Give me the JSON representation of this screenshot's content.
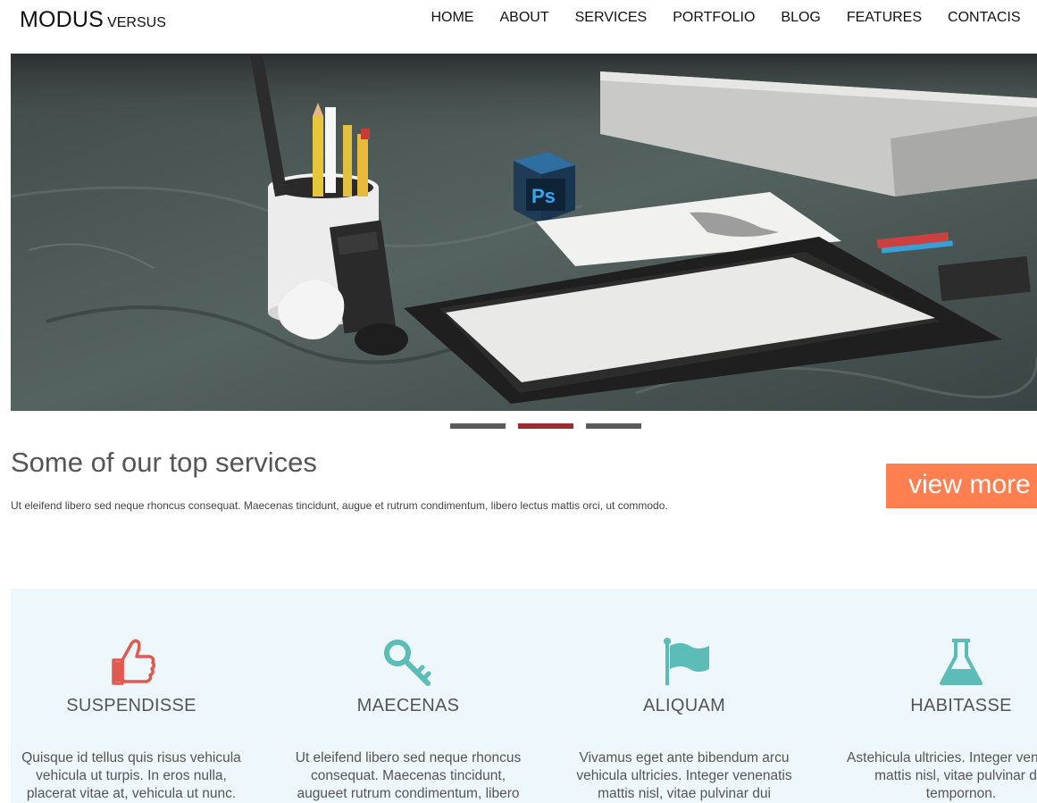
{
  "header": {
    "logo_main": "MODUS",
    "logo_sub": "VERSUS",
    "nav": [
      "HOME",
      "ABOUT",
      "SERVICES",
      "PORTFOLIO",
      "BLOG",
      "FEATURES",
      "CONTACIS"
    ]
  },
  "slider": {
    "slide_count": 3,
    "active_index": 1,
    "photoshop_label": "Ps"
  },
  "services": {
    "title": "Some of our top services",
    "text": "Ut eleifend libero sed neque rhoncus consequat. Maecenas tincidunt, augue et rutrum condimentum, libero lectus mattis orci, ut commodo.",
    "button_label": "view more"
  },
  "features": [
    {
      "icon": "thumbs-up-icon",
      "title": "SUSPENDISSE",
      "text": "Quisque id tellus quis risus vehicula vehicula ut turpis. In eros nulla, placerat vitae at, vehicula ut nunc."
    },
    {
      "icon": "key-icon",
      "title": "MAECENAS",
      "text": "Ut eleifend libero sed neque rhoncus consequat. Maecenas tincidunt, augueet rutrum condimentum, libero"
    },
    {
      "icon": "flag-icon",
      "title": "ALIQUAM",
      "text": "Vivamus eget ante bibendum arcu vehicula ultricies. Integer venenatis mattis nisl, vitae pulvinar dui"
    },
    {
      "icon": "flask-icon",
      "title": "HABITASSE",
      "text": "Astehicula ultricies. Integer venenatis mattis nisl, vitae pulvinar dui tempornon."
    }
  ],
  "colors": {
    "accent": "#ff7f50",
    "active_dot": "#9b2c2c",
    "inactive_dot": "#5a5a5a",
    "icon_red": "#e05a4f",
    "icon_teal": "#5bbcb8",
    "features_bg": "#eef7fb"
  }
}
